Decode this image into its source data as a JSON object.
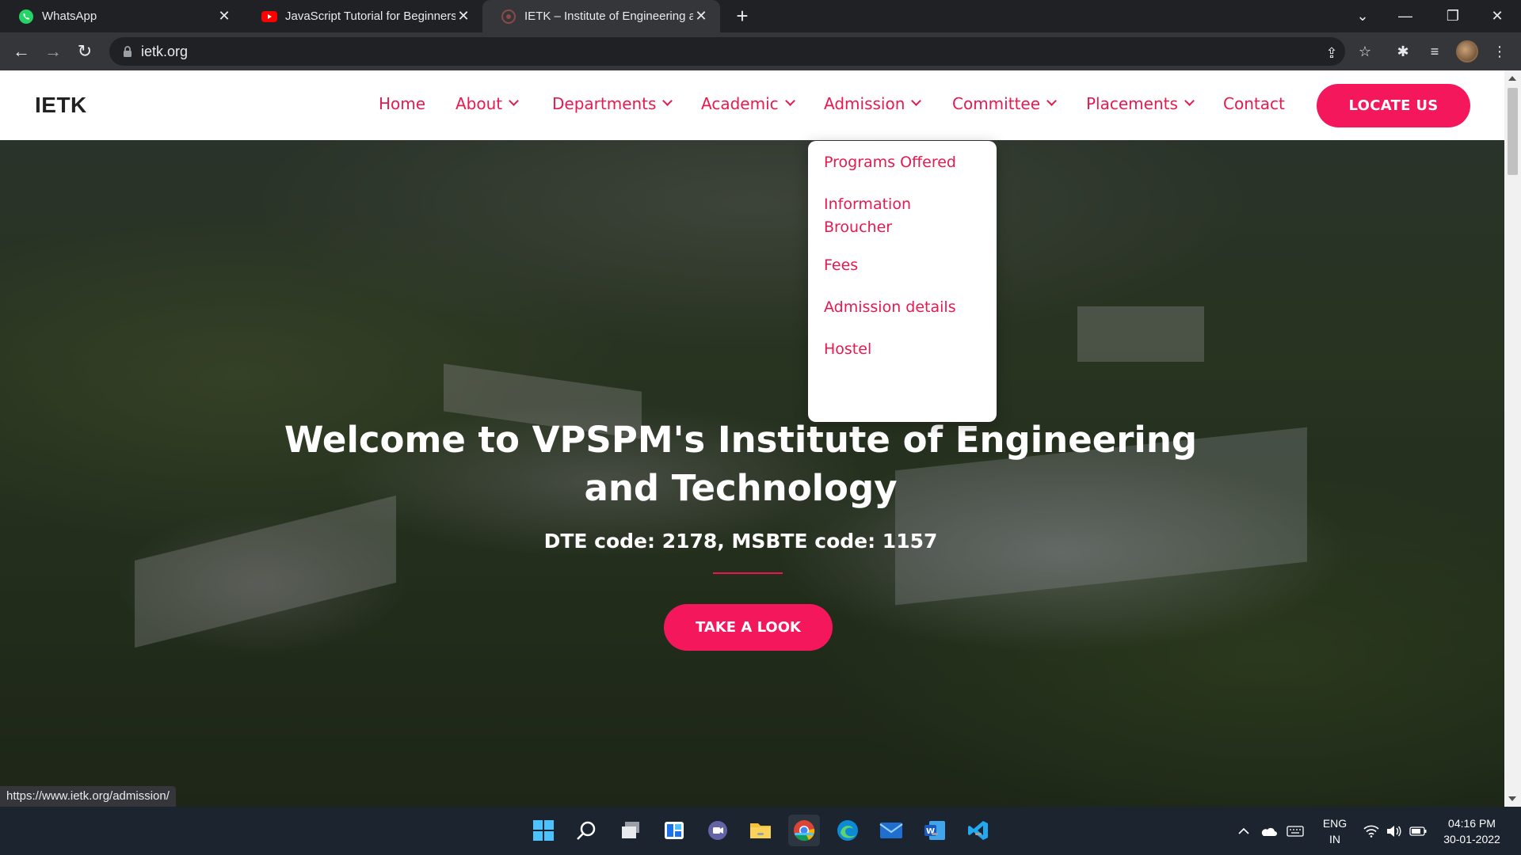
{
  "browser": {
    "tabs": [
      {
        "title": "WhatsApp",
        "icon": "whatsapp-icon"
      },
      {
        "title": "JavaScript Tutorial for Beginners:",
        "icon": "youtube-icon"
      },
      {
        "title": "IETK – Institute of Engineering an",
        "icon": "site-favicon"
      }
    ],
    "url": "ietk.org",
    "status_url": "https://www.ietk.org/admission/"
  },
  "site": {
    "logo": "IETK",
    "nav": {
      "home": "Home",
      "about": "About",
      "departments": "Departments",
      "academic": "Academic",
      "admission": "Admission",
      "committee": "Committee",
      "placements": "Placements",
      "contact": "Contact"
    },
    "locate_btn": "LOCATE US",
    "admission_menu": {
      "programs": "Programs Offered",
      "brochure": "Information Broucher",
      "fees": "Fees",
      "details": "Admission details",
      "hostel": "Hostel"
    },
    "hero": {
      "title": "Welcome to VPSPM's Institute of Engineering and Technology",
      "subtitle": "DTE code: 2178, MSBTE code: 1157",
      "cta": "TAKE A LOOK"
    },
    "colors": {
      "accent": "#f5175b",
      "link": "#e8194f"
    }
  },
  "taskbar": {
    "apps": [
      "windows-start-icon",
      "search-icon",
      "task-view-icon",
      "widgets-icon",
      "teams-chat-icon",
      "file-explorer-icon",
      "chrome-icon",
      "edge-icon",
      "mail-icon",
      "word-icon",
      "vscode-icon"
    ],
    "language": "ENG",
    "region": "IN",
    "time": "04:16 PM",
    "date": "30-01-2022"
  }
}
